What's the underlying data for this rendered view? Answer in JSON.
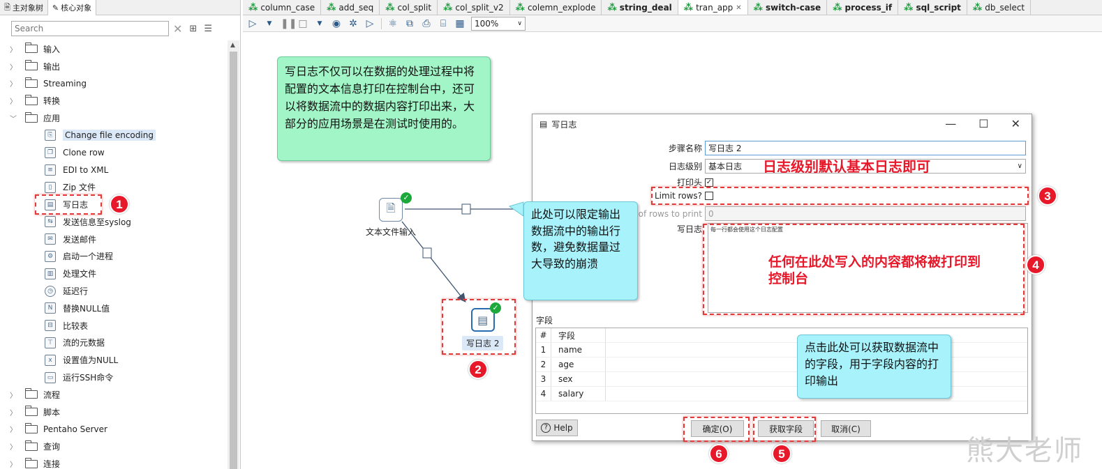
{
  "left_tabs": [
    {
      "label": "主对象树",
      "active": false
    },
    {
      "label": "核心对象",
      "active": true
    }
  ],
  "search": {
    "placeholder": "Search"
  },
  "tree": {
    "folders_top": [
      "输入",
      "输出",
      "Streaming",
      "转换",
      "应用"
    ],
    "app_children": [
      "Change file encoding",
      "Clone row",
      "EDI to XML",
      "Zip 文件",
      "写日志",
      "发送信息至syslog",
      "发送邮件",
      "启动一个进程",
      "处理文件",
      "延迟行",
      "替换NULL值",
      "比较表",
      "流的元数据",
      "设置值为NULL",
      "运行SSH命令"
    ],
    "folders_bottom": [
      "流程",
      "脚本",
      "Pentaho Server",
      "查询",
      "连接"
    ]
  },
  "main_tabs": [
    {
      "label": "column_case",
      "bold": false
    },
    {
      "label": "add_seq",
      "bold": false
    },
    {
      "label": "col_split",
      "bold": false
    },
    {
      "label": "col_split_v2",
      "bold": false
    },
    {
      "label": "colemn_explode",
      "bold": false
    },
    {
      "label": "string_deal",
      "bold": true
    },
    {
      "label": "tran_app",
      "bold": false,
      "active": true
    },
    {
      "label": "switch-case",
      "bold": true
    },
    {
      "label": "process_if",
      "bold": true
    },
    {
      "label": "sql_script",
      "bold": true
    },
    {
      "label": "db_select",
      "bold": false
    }
  ],
  "toolbar": {
    "zoom": "100%"
  },
  "notes": {
    "green": "写日志不仅可以在数据的处理过程中将配置的文本信息打印在控制台中，还可以将数据流中的数据内容打印出来，大部分的应用场景是在测试时使用的。",
    "limit": "此处可以限定输出数据流中的输出行数，避免数据量过大导致的崩溃",
    "fields": "点击此处可以获取数据流中的字段，用于字段内容的打印输出"
  },
  "steps": {
    "input": "文本文件输入",
    "log": "写日志 2"
  },
  "badges": [
    "1",
    "2",
    "3",
    "4",
    "5",
    "6"
  ],
  "dialog": {
    "title": "写日志",
    "step_name_label": "步骤名称",
    "step_name_value": "写日志 2",
    "log_level_label": "日志级别",
    "log_level_value": "基本日志",
    "print_header_label": "打印头",
    "limit_rows_label": "Limit rows?",
    "rows_to_print_label": "of rows to print",
    "rows_to_print_value": "0",
    "write_log_label": "写日志",
    "write_log_value": "每一行都会使用这个日志配置",
    "fields_label": "字段",
    "fields_header": [
      "#",
      "字段"
    ],
    "fields": [
      "name",
      "age",
      "sex",
      "salary"
    ],
    "help_label": "Help",
    "ok_label": "确定(O)",
    "get_fields_label": "获取字段",
    "cancel_label": "取消(C)"
  },
  "annotations": {
    "log_level": "日志级别默认基本日志即可",
    "write_log": "任何在此处写入的内容都将被打印到控制台"
  },
  "watermark": "熊大老师"
}
